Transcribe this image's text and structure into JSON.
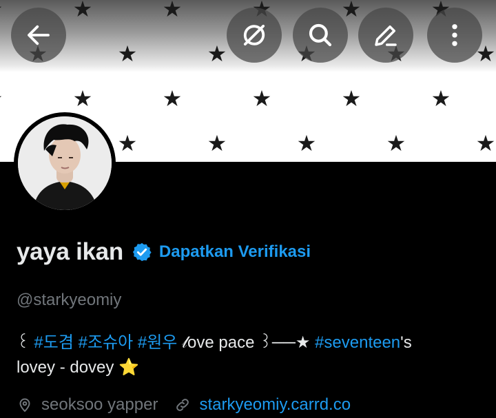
{
  "header": {
    "back_icon": "arrow-left-icon",
    "grok_icon": "grok-icon",
    "search_icon": "search-icon",
    "edit_icon": "edit-icon",
    "more_icon": "more-vertical-icon"
  },
  "banner": {
    "pattern_glyph": "★",
    "background_color": "#ffffff",
    "star_color": "#1a1a1a"
  },
  "profile": {
    "name": "yaya ikan",
    "verify_cta": "Dapatkan Verifikasi",
    "handle": "@starkyeomiy",
    "bio": {
      "lead": "꒰ ",
      "tag1": "#도겸",
      "tag2": "#조슈아",
      "tag3": "#원우",
      "middle": " 𝓁ove pace ꒱──★ ",
      "tag4": "#seventeen",
      "tail": "'s",
      "line2": "lovey - dovey ⭐"
    },
    "location": "seoksoo yapper",
    "website": "starkyeomiy.carrd.co"
  },
  "colors": {
    "accent": "#1d9bf0",
    "muted": "#71767b",
    "text": "#e7e9ea",
    "background": "#000000"
  }
}
